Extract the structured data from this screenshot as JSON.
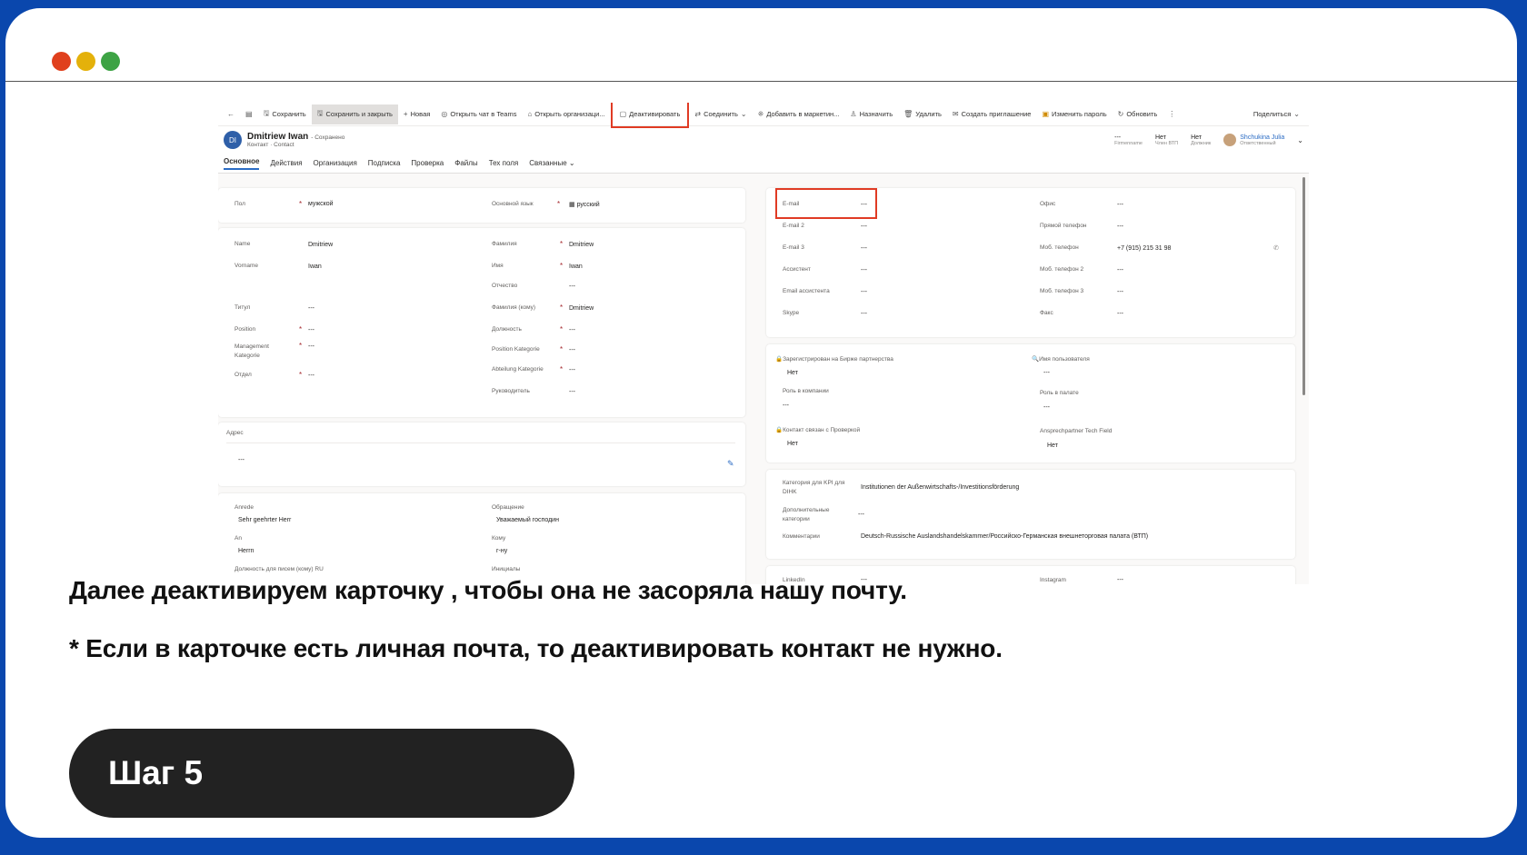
{
  "window": {
    "dots": [
      "#e0401d",
      "#e4b10b",
      "#3da344"
    ]
  },
  "toolbar": {
    "items": [
      "Сохранить",
      "Сохранить и закрыть",
      "Новая",
      "Открыть чат в Teams",
      "Открыть организаци...",
      "Деактивировать",
      "Соединить",
      "Добавить в маркетин...",
      "Назначить",
      "Удалить",
      "Создать приглашение",
      "Изменить пароль",
      "Обновить"
    ],
    "share": "Поделиться"
  },
  "record": {
    "initials": "DI",
    "name": "Dmitriew Iwan",
    "saved": "- Сохранено",
    "type": "Контакт · Contact",
    "stats": [
      {
        "value": "---",
        "label": "Firmenname"
      },
      {
        "value": "Нет",
        "label": "Член ВТП"
      },
      {
        "value": "Нет",
        "label": "Должник"
      }
    ],
    "owner": {
      "name": "Shchukina Julia",
      "role": "Ответственный"
    }
  },
  "tabs": [
    "Основное",
    "Действия",
    "Организация",
    "Подписка",
    "Проверка",
    "Файлы",
    "Тех поля",
    "Связанные"
  ],
  "left": {
    "pol_label": "Пол",
    "pol_value": "мужской",
    "lang_label": "Основной язык",
    "lang_value": "русский",
    "rows_a": [
      {
        "label": "Name",
        "value": "Dmitriew"
      },
      {
        "label": "Vorname",
        "value": "Iwan"
      },
      {
        "label": "Титул",
        "value": "---"
      },
      {
        "label": "Position",
        "value": "---"
      },
      {
        "label": "Management Kategorie",
        "value": "---"
      },
      {
        "label": "Отдел",
        "value": "---"
      }
    ],
    "rows_b": [
      {
        "label": "Фамилия",
        "value": "Dmitriew"
      },
      {
        "label": "Имя",
        "value": "Iwan"
      },
      {
        "label": "Отчество",
        "value": "---"
      },
      {
        "label": "Фамилия (кому)",
        "value": "Dmitriew"
      },
      {
        "label": "Должность",
        "value": "---"
      },
      {
        "label": "Position Kategorie",
        "value": "---"
      },
      {
        "label": "Abteilung Kategorie",
        "value": "---"
      },
      {
        "label": "Руководитель",
        "value": "---"
      }
    ],
    "address_label": "Адрес",
    "address_value": "---",
    "anrede_label": "Anrede",
    "anrede_value": "Sehr geehrter Herr",
    "obr_label": "Обращение",
    "obr_value": "Уважаемый господин",
    "an_label": "An",
    "an_value": "Herrn",
    "komu_label": "Кому",
    "komu_value": "г-ну",
    "dolzh_label": "Должность для писем (кому) RU",
    "init_label": "Инициалы"
  },
  "right": {
    "email_rows": [
      {
        "label": "E-mail",
        "value": "---"
      },
      {
        "label": "E-mail 2",
        "value": "---"
      },
      {
        "label": "E-mail 3",
        "value": "---"
      },
      {
        "label": "Ассистент",
        "value": "---"
      },
      {
        "label": "Email ассистента",
        "value": "---"
      },
      {
        "label": "Skype",
        "value": "---"
      }
    ],
    "phone_rows": [
      {
        "label": "Офис",
        "value": "---"
      },
      {
        "label": "Прямой телефон",
        "value": "---"
      },
      {
        "label": "Моб. телефон",
        "value": "+7 (915) 215 31 98"
      },
      {
        "label": "Моб. телефон 2",
        "value": "---"
      },
      {
        "label": "Моб. телефон 3",
        "value": "---"
      },
      {
        "label": "Факс",
        "value": "---"
      }
    ],
    "reg_label": "Зарегистрирован на Бирже партнерства",
    "reg_value": "Нет",
    "user_label": "Имя пользователя",
    "user_value": "---",
    "role_label": "Роль в компании",
    "role_value": "---",
    "chamber_label": "Роль в палате",
    "chamber_value": "---",
    "linked_label": "Контакт связан с Проверкой",
    "linked_value": "Нет",
    "tech_label": "Ansprechpartner Tech Field",
    "tech_value": "Нет",
    "kpi_label": "Категория для KPI для DIHK",
    "kpi_value": "Institutionen der Außenwirtschafts-/Investitionsförderung",
    "extra_label": "Дополнительные категории",
    "extra_value": "---",
    "comment_label": "Комментарии",
    "comment_value": "Deutsch-Russische Auslandshandelskammer/Российско-Германская внешнеторговая палата (ВТП)",
    "linkedin_label": "LinkedIn",
    "linkedin_value": "---",
    "instagram_label": "Instagram",
    "instagram_value": "---"
  },
  "caption": {
    "line1": "Далее деактивируем карточку , чтобы она не засоряла нашу почту.",
    "line2": "* Если в карточке есть личная почта, то деактивировать контакт не нужно."
  },
  "step": "Шаг 5"
}
